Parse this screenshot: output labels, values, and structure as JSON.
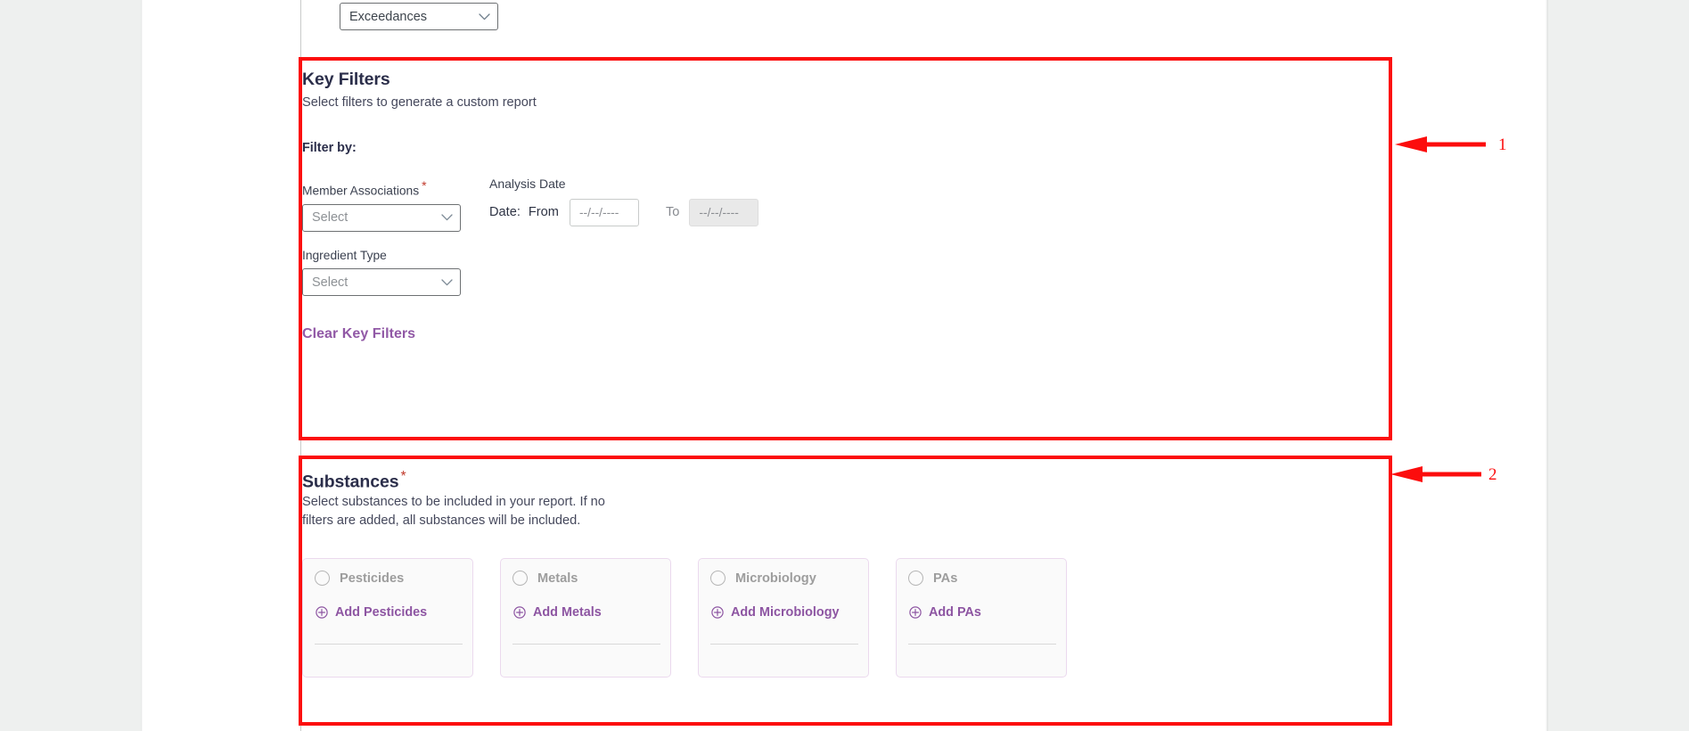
{
  "report_type_select": {
    "name": "report-type",
    "value": "Exceedances",
    "icon": "chevron-down-icon"
  },
  "key_filters": {
    "title": "Key Filters",
    "subtitle": "Select filters to generate a custom report",
    "filter_by_label": "Filter by:",
    "member_associations": {
      "label": "Member Associations",
      "required_marker": "*",
      "placeholder": "Select",
      "value": "Select"
    },
    "ingredient_type": {
      "label": "Ingredient Type",
      "placeholder": "Select",
      "value": "Select"
    },
    "analysis_date": {
      "group_label": "Analysis Date",
      "date_prefix": "Date:",
      "from_label": "From",
      "from_value": "--/--/----",
      "to_label": "To",
      "to_value": "--/--/----",
      "to_disabled": true
    },
    "clear_link": "Clear Key Filters"
  },
  "substances": {
    "title": "Substances",
    "required_marker": "*",
    "subtitle": "Select substances to be included in your report. If no filters are added, all substances will be included.",
    "cards": [
      {
        "label": "Pesticides",
        "add_label": "Add Pesticides",
        "selected": false
      },
      {
        "label": "Metals",
        "add_label": "Add Metals",
        "selected": false
      },
      {
        "label": "Microbiology",
        "add_label": "Add Microbiology",
        "selected": false
      },
      {
        "label": "PAs",
        "add_label": "Add PAs",
        "selected": false
      }
    ]
  },
  "annotations": [
    {
      "number": "1",
      "target": "Key Filters section"
    },
    {
      "number": "2",
      "target": "Substances section"
    }
  ],
  "colors": {
    "annotation_red": "#fc0d0d",
    "link_purple": "#9159a6",
    "heading_navy": "#2b2e4a",
    "required_red": "#c0392b",
    "card_border": "#ebd9ee",
    "page_background": "#eef0ef"
  }
}
